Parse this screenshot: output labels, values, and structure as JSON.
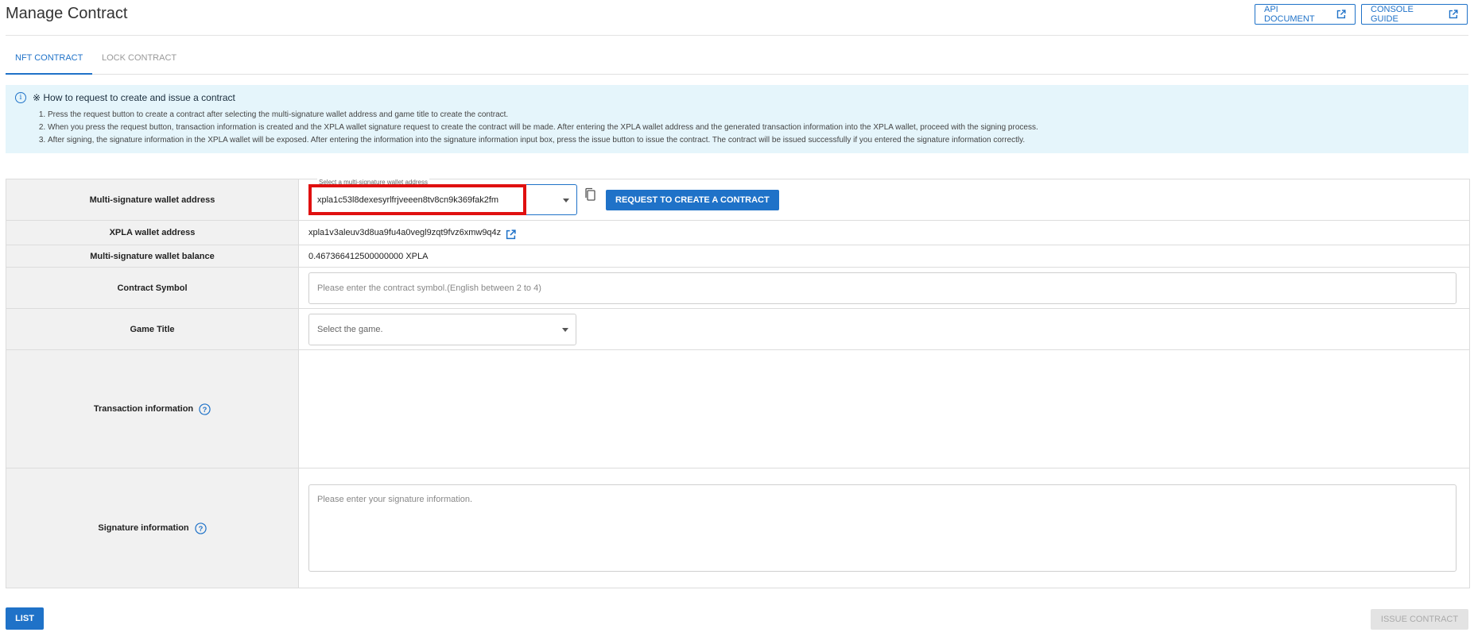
{
  "header": {
    "title": "Manage Contract",
    "api_document": "API DOCUMENT",
    "console_guide": "CONSOLE GUIDE"
  },
  "tabs": [
    {
      "label": "NFT CONTRACT",
      "active": true
    },
    {
      "label": "LOCK CONTRACT",
      "active": false
    }
  ],
  "info": {
    "title": "※ How to request to create and issue a contract",
    "steps": [
      "Press the request button to create a contract after selecting the multi-signature wallet address and game title to create the contract.",
      "When you press the request button, transaction information is created and the XPLA wallet signature request to create the contract will be made. After entering the XPLA wallet address and the generated transaction information into the XPLA wallet, proceed with the signing process.",
      "After signing, the signature information in the XPLA wallet will be exposed. After entering the information into the signature information input box, press the issue button to issue the contract. The contract will be issued successfully if you entered the signature information correctly."
    ]
  },
  "form": {
    "multisig": {
      "label": "Multi-signature wallet address",
      "select_label": "Select a multi-signature wallet address",
      "value": "xpla1c53l8dexesyrlfrjveeen8tv8cn9k369fak2fm",
      "request_button": "REQUEST TO CREATE A CONTRACT"
    },
    "xpla_wallet": {
      "label": "XPLA wallet address",
      "value": "xpla1v3aleuv3d8ua9fu4a0vegl9zqt9fvz6xmw9q4z"
    },
    "balance": {
      "label": "Multi-signature wallet balance",
      "value": "0.467366412500000000 XPLA"
    },
    "symbol": {
      "label": "Contract Symbol",
      "placeholder": "Please enter the contract symbol.(English between 2 to 4)"
    },
    "game": {
      "label": "Game Title",
      "placeholder": "Select the game."
    },
    "transaction": {
      "label": "Transaction information"
    },
    "signature": {
      "label": "Signature information",
      "placeholder": "Please enter your signature information."
    }
  },
  "footer": {
    "list": "LIST",
    "issue": "ISSUE CONTRACT"
  },
  "colors": {
    "accent": "#1f72c8",
    "info_background": "#e5f5fb",
    "highlight": "#e01010"
  },
  "icons": [
    "info-icon",
    "external-link-icon",
    "copy-icon",
    "chevron-down-icon",
    "help-icon"
  ]
}
